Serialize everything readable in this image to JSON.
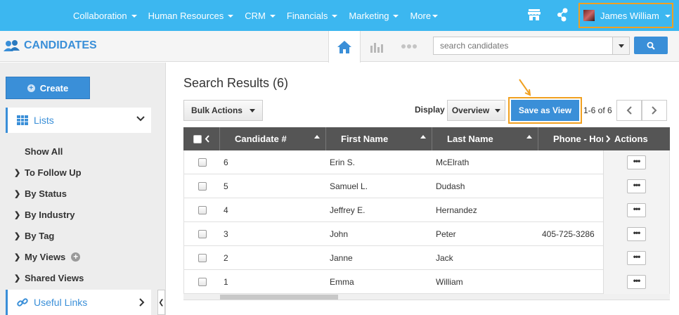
{
  "nav": {
    "items": [
      {
        "label": "Collaboration"
      },
      {
        "label": "Human Resources"
      },
      {
        "label": "CRM"
      },
      {
        "label": "Financials"
      },
      {
        "label": "Marketing"
      },
      {
        "label": "More"
      }
    ],
    "user_name": "James William",
    "icons": [
      "store-icon",
      "share-icon"
    ]
  },
  "app": {
    "title": "CANDIDATES",
    "tabs": [
      "home-icon",
      "chart-icon",
      "more-dots-icon"
    ],
    "search_placeholder": "search candidates"
  },
  "sidebar": {
    "create_label": "Create",
    "lists_label": "Lists",
    "items": [
      {
        "label": "Show All",
        "has_arrow": false
      },
      {
        "label": "To Follow Up",
        "has_arrow": true
      },
      {
        "label": "By Status",
        "has_arrow": true
      },
      {
        "label": "By Industry",
        "has_arrow": true
      },
      {
        "label": "By Tag",
        "has_arrow": true
      },
      {
        "label": "My Views",
        "has_arrow": true
      },
      {
        "label": "Shared Views",
        "has_arrow": true
      }
    ],
    "useful_links_label": "Useful Links"
  },
  "main": {
    "results_title": "Search Results (6)",
    "bulk_actions_label": "Bulk Actions",
    "display_label": "Display",
    "display_value": "Overview",
    "save_view_label": "Save as View",
    "page_info": "1-6 of 6",
    "accent_color": "#3a8fd8",
    "highlight_color": "#f0a020"
  },
  "table": {
    "columns": [
      "Candidate #",
      "First Name",
      "Last Name",
      "Phone - Hom",
      "Actions"
    ],
    "rows": [
      {
        "num": "6",
        "first": "Erin S.",
        "last": "McElrath",
        "phone": ""
      },
      {
        "num": "5",
        "first": "Samuel L.",
        "last": "Dudash",
        "phone": ""
      },
      {
        "num": "4",
        "first": "Jeffrey E.",
        "last": "Hernandez",
        "phone": ""
      },
      {
        "num": "3",
        "first": "John",
        "last": "Peter",
        "phone": "405-725-3286"
      },
      {
        "num": "2",
        "first": "Janne",
        "last": "Jack",
        "phone": ""
      },
      {
        "num": "1",
        "first": "Emma",
        "last": "William",
        "phone": ""
      }
    ],
    "action_glyph": "•••"
  }
}
